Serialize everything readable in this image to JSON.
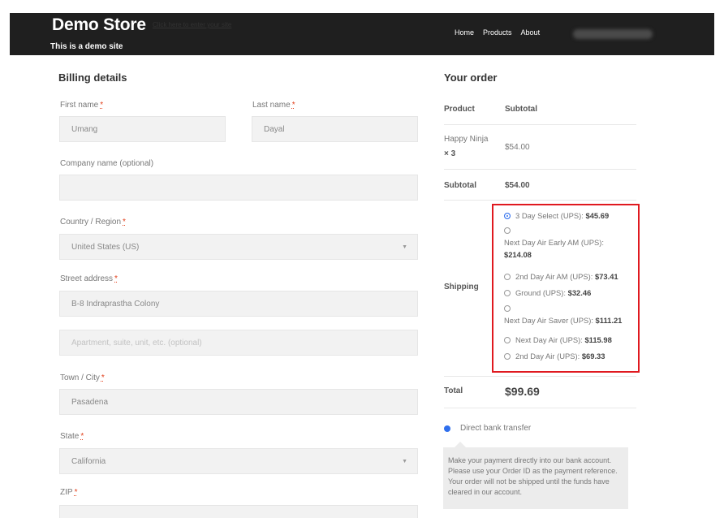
{
  "header": {
    "site_title": "Demo Store",
    "skip_link": "Click here to enter your site",
    "tagline": "This is a demo site",
    "nav": [
      "Home",
      "Products",
      "About"
    ]
  },
  "billing": {
    "title": "Billing details",
    "first_name_label": "First name",
    "first_name_value": "Umang",
    "last_name_label": "Last name",
    "last_name_value": "Dayal",
    "company_label": "Company name (optional)",
    "company_value": "",
    "country_label": "Country / Region",
    "country_value": "United States (US)",
    "street_label": "Street address",
    "street_value": "B-8 Indraprastha Colony",
    "apartment_placeholder": "Apartment, suite, unit, etc. (optional)",
    "city_label": "Town / City",
    "city_value": "Pasadena",
    "state_label": "State",
    "state_value": "California",
    "zip_label": "ZIP",
    "required_mark": "*"
  },
  "order": {
    "title": "Your order",
    "product_header": "Product",
    "subtotal_header": "Subtotal",
    "item_name": "Happy Ninja",
    "item_qty": "× 3",
    "item_subtotal": "$54.00",
    "subtotal_label": "Subtotal",
    "subtotal_value": "$54.00",
    "shipping_label": "Shipping",
    "shipping_options": [
      {
        "name": "3 Day Select (UPS):",
        "price": "$45.69",
        "selected": true
      },
      {
        "name": "Next Day Air Early AM (UPS):",
        "price": "$214.08",
        "selected": false
      },
      {
        "name": "2nd Day Air AM (UPS):",
        "price": "$73.41",
        "selected": false
      },
      {
        "name": "Ground (UPS):",
        "price": "$32.46",
        "selected": false
      },
      {
        "name": "Next Day Air Saver (UPS):",
        "price": "$111.21",
        "selected": false
      },
      {
        "name": "Next Day Air (UPS):",
        "price": "$115.98",
        "selected": false
      },
      {
        "name": "2nd Day Air (UPS):",
        "price": "$69.33",
        "selected": false
      }
    ],
    "total_label": "Total",
    "total_value": "$99.69",
    "payment_label": "Direct bank transfer",
    "payment_desc": "Make your payment directly into our bank account. Please use your Order ID as the payment reference. Your order will not be shipped until the funds have cleared in our account."
  },
  "colors": {
    "header_bg": "#1f1f1f",
    "highlight_border": "#e0191f",
    "radio_accent": "#2f6fed",
    "required": "#e2401c"
  }
}
